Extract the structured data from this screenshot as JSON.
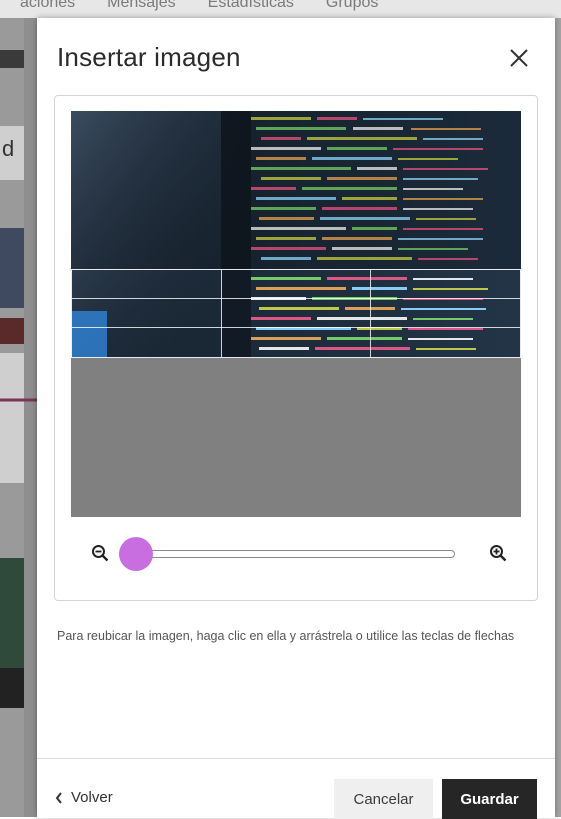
{
  "background": {
    "nav_items": [
      "aciones",
      "Mensajes",
      "Estadísticas",
      "Grupos"
    ],
    "strip_letter": "d"
  },
  "modal": {
    "title": "Insertar imagen",
    "close_icon": "close-icon",
    "zoom": {
      "zoom_out_icon": "zoom-out-icon",
      "zoom_in_icon": "zoom-in-icon",
      "level_fraction": 0.05
    },
    "hint": "Para reubicar la imagen, haga clic en ella y arrástrela o utilice las teclas de flechas",
    "footer": {
      "back_label": "Volver",
      "cancel_label": "Cancelar",
      "save_label": "Guardar"
    }
  },
  "colors": {
    "accent_slider": "#c86ee0",
    "save_button": "#262626",
    "arrow": "#7a3552"
  }
}
